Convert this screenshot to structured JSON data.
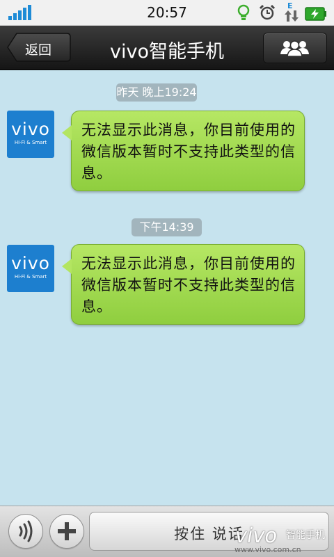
{
  "status_bar": {
    "time": "20:57",
    "icons": [
      "signal-icon",
      "bulb-icon",
      "alarm-icon",
      "data-arrows-icon",
      "battery-charging-icon"
    ],
    "network_type": "E",
    "accent": "#1e8bd6"
  },
  "header": {
    "back_label": "返回",
    "title": "vivo智能手机",
    "contacts_icon": "contacts-icon"
  },
  "messages": [
    {
      "timestamp": "昨天 晚上19:24",
      "avatar_text": "vivo",
      "avatar_subtext": "Hi-Fi & Smart",
      "text": "无法显示此消息，你目前使用的微信版本暂时不支持此类型的信息。"
    },
    {
      "timestamp": "下午14:39",
      "avatar_text": "vivo",
      "avatar_subtext": "Hi-Fi & Smart",
      "text": "无法显示此消息，你目前使用的微信版本暂时不支持此类型的信息。"
    }
  ],
  "bottom_bar": {
    "voice_icon": "voice-icon",
    "plus_icon": "plus-icon",
    "talk_label": "按住 说话"
  },
  "watermark": {
    "logo": "vivo",
    "brand": "智能手机",
    "url": "www.vivo.com.cn"
  },
  "colors": {
    "chat_background": "#c6e3ee",
    "bubble": "#a6dc52",
    "timestamp_badge": "#a2b5bd",
    "avatar": "#1d7fcf"
  }
}
